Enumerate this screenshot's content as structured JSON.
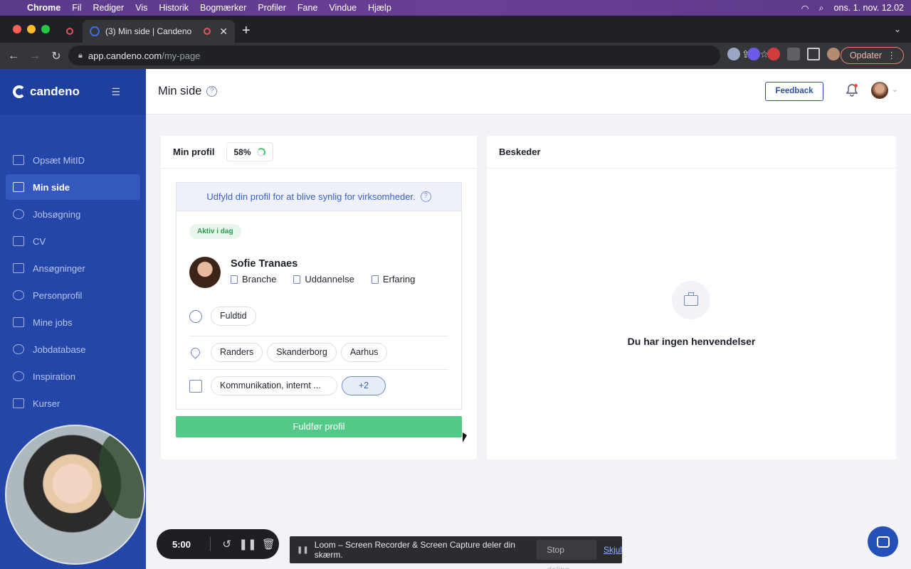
{
  "os_menubar": {
    "app": "Chrome",
    "items": [
      "Fil",
      "Rediger",
      "Vis",
      "Historik",
      "Bogmærker",
      "Profiler",
      "Fane",
      "Vindue",
      "Hjælp"
    ],
    "clock": "ons. 1. nov. 12.02"
  },
  "browser": {
    "tab_title": "(3) Min side | Candeno",
    "url_host": "app.candeno.com",
    "url_path": "/my-page",
    "update_label": "Opdater"
  },
  "sidebar": {
    "brand": "candeno",
    "items": [
      {
        "label": "Opsæt MitID",
        "icon": "id-card-icon",
        "active": false
      },
      {
        "label": "Min side",
        "icon": "calendar-icon",
        "active": true
      },
      {
        "label": "Jobsøgning",
        "icon": "handshake-icon",
        "active": false
      },
      {
        "label": "CV",
        "icon": "document-icon",
        "active": false
      },
      {
        "label": "Ansøgninger",
        "icon": "file-icon",
        "active": false
      },
      {
        "label": "Personprofil",
        "icon": "user-icon",
        "active": false
      },
      {
        "label": "Mine jobs",
        "icon": "briefcase-icon",
        "active": false
      },
      {
        "label": "Jobdatabase",
        "icon": "database-icon",
        "active": false
      },
      {
        "label": "Inspiration",
        "icon": "lightbulb-icon",
        "active": false
      },
      {
        "label": "Kurser",
        "icon": "monitor-icon",
        "active": false
      }
    ]
  },
  "header": {
    "title": "Min side",
    "feedback_label": "Feedback"
  },
  "profile_card": {
    "title": "Min profil",
    "completion": "58%",
    "prompt": "Udfyld din profil for at blive synlig for virksomheder.",
    "status_badge": "Aktiv i dag",
    "name": "Sofie Tranaes",
    "facts": [
      "Branche",
      "Uddannelse",
      "Erfaring"
    ],
    "employment": [
      "Fuldtid"
    ],
    "locations": [
      "Randers",
      "Skanderborg",
      "Aarhus"
    ],
    "skills": [
      "Kommunikation, internt ...",
      "+2"
    ],
    "cta_label": "Fuldfør profil"
  },
  "messages_card": {
    "title": "Beskeder",
    "empty_text": "Du har ingen henvendelser"
  },
  "recorder": {
    "time": "5:00",
    "share_notice": "Loom – Screen Recorder & Screen Capture deler din skærm.",
    "stop_label": "Stop deling",
    "hide_label": "Skjul"
  },
  "colors": {
    "sidebar": "#2346a8",
    "primary": "#2a4fb2",
    "cta": "#52c987"
  }
}
